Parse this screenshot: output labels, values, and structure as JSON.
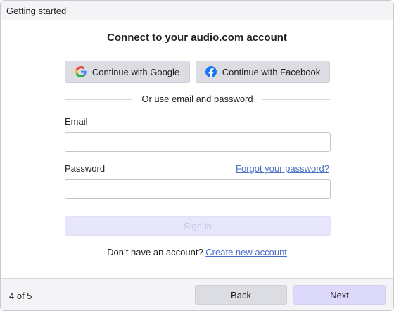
{
  "window": {
    "title": "Getting started"
  },
  "heading": "Connect to your audio.com account",
  "social": {
    "google_label": "Continue with Google",
    "facebook_label": "Continue with Facebook"
  },
  "divider_text": "Or use email and password",
  "form": {
    "email_label": "Email",
    "email_value": "",
    "password_label": "Password",
    "password_value": "",
    "forgot_link": "Forgot your password?",
    "signin_label": "Sign in"
  },
  "signup": {
    "prompt": "Don’t have an account?",
    "link": "Create new account"
  },
  "footer": {
    "step": "4 of 5",
    "back_label": "Back",
    "next_label": "Next"
  },
  "colors": {
    "link": "#4a6fc9",
    "signin_disabled_bg": "#e8e6fb",
    "next_bg": "#dcd9fb",
    "google_blue": "#4285F4",
    "facebook_blue": "#1877F2"
  },
  "icons": {
    "google": "google-icon",
    "facebook": "facebook-icon"
  }
}
